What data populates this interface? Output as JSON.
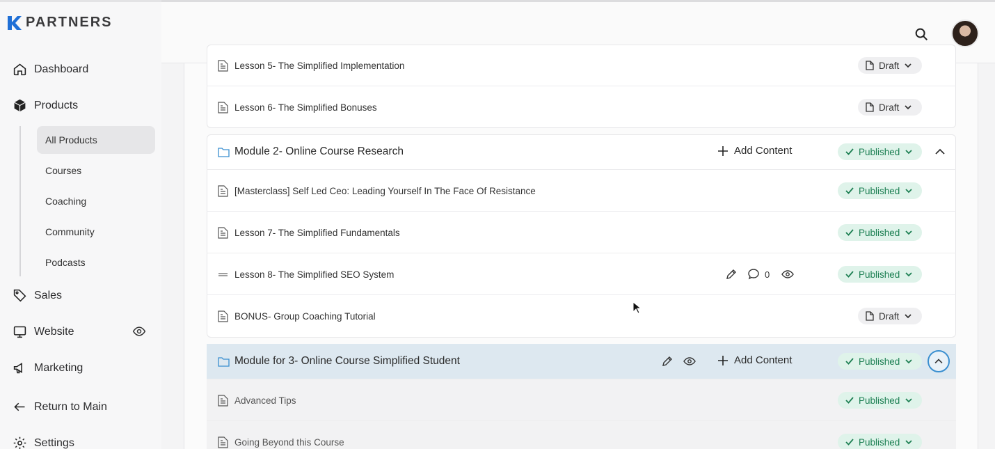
{
  "brand": {
    "name": "PARTNERS"
  },
  "sidebar": {
    "items": [
      {
        "label": "Dashboard",
        "icon": "home-icon"
      },
      {
        "label": "Products",
        "icon": "box-icon"
      },
      {
        "label": "Sales",
        "icon": "tag-icon"
      },
      {
        "label": "Website",
        "icon": "monitor-icon"
      },
      {
        "label": "Marketing",
        "icon": "megaphone-icon"
      },
      {
        "label": "Return to Main",
        "icon": "arrow-left-icon"
      },
      {
        "label": "Settings",
        "icon": "gear-icon"
      }
    ],
    "products_sub": [
      {
        "label": "All Products",
        "active": true
      },
      {
        "label": "Courses"
      },
      {
        "label": "Coaching"
      },
      {
        "label": "Community"
      },
      {
        "label": "Podcasts"
      }
    ]
  },
  "header": {
    "search_icon": "search-icon",
    "avatar": "user-avatar"
  },
  "content": {
    "rows": [
      {
        "label": "Lesson 5- The Simplified Implementation",
        "status": "Draft"
      },
      {
        "label": "Lesson 6- The Simplified Bonuses",
        "status": "Draft"
      },
      {
        "label": "Module 2- Online Course Research",
        "status": "Published",
        "add": "Add Content"
      },
      {
        "label": "[Masterclass] Self Led Ceo: Leading Yourself In The Face Of Resistance",
        "status": "Published"
      },
      {
        "label": "Lesson 7- The Simplified Fundamentals",
        "status": "Published"
      },
      {
        "label": "Lesson 8- The Simplified SEO System",
        "status": "Published",
        "comments": "0"
      },
      {
        "label": "BONUS- Group Coaching Tutorial",
        "status": "Draft"
      },
      {
        "label": "Module for 3- Online Course Simplified Student",
        "status": "Published",
        "add": "Add Content"
      },
      {
        "label": "Advanced Tips",
        "status": "Published"
      },
      {
        "label": "Going Beyond this Course",
        "status": "Published"
      }
    ]
  },
  "colors": {
    "published_bg": "#dff3ea",
    "published_fg": "#1c7f52",
    "draft_bg": "#efeff1",
    "highlight_row": "#dde8f0",
    "focus_ring": "#3a8fd0"
  }
}
